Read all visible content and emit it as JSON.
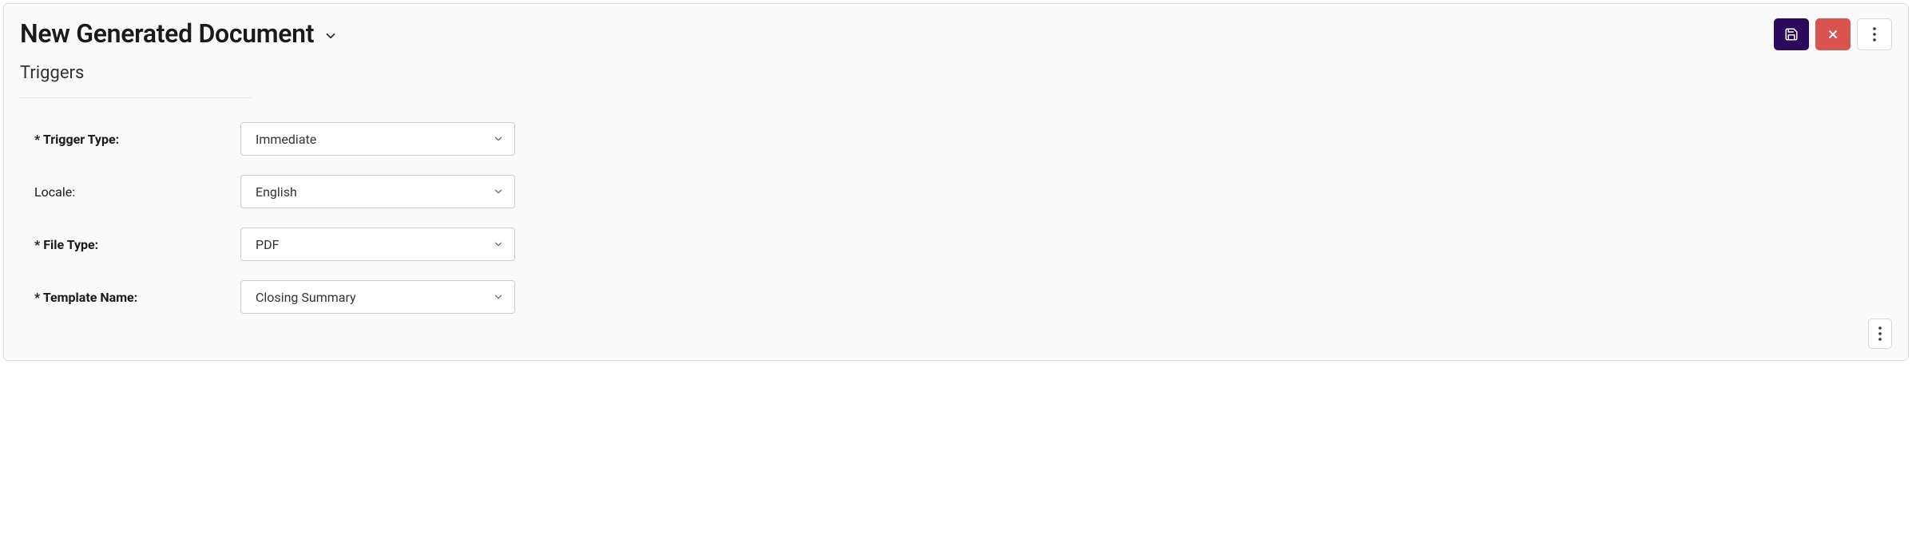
{
  "header": {
    "title": "New Generated Document"
  },
  "section": {
    "title": "Triggers"
  },
  "form": {
    "trigger_type": {
      "label": "* Trigger Type:",
      "value": "Immediate"
    },
    "locale": {
      "label": "Locale:",
      "value": "English"
    },
    "file_type": {
      "label": "* File Type:",
      "value": "PDF"
    },
    "template_name": {
      "label": "* Template Name:",
      "value": "Closing Summary"
    }
  }
}
